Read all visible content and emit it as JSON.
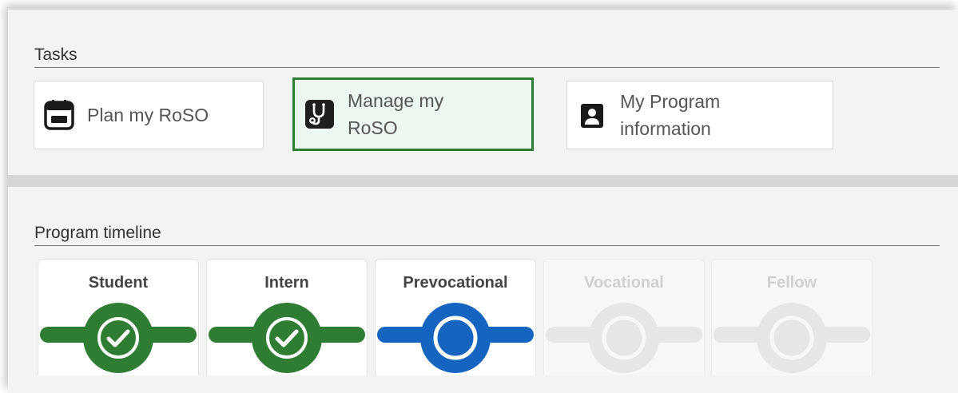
{
  "tasks": {
    "title": "Tasks",
    "items": [
      {
        "label_line1": "Plan my RoSO",
        "label_line2": "",
        "icon": "calendar-icon"
      },
      {
        "label_line1": "Manage my",
        "label_line2": "RoSO",
        "icon": "stethoscope-icon"
      },
      {
        "label_line1": "My Program",
        "label_line2": "information",
        "icon": "contact-card-icon"
      }
    ]
  },
  "timeline": {
    "title": "Program timeline",
    "stages": [
      {
        "label": "Student",
        "status": "completed"
      },
      {
        "label": "Intern",
        "status": "completed"
      },
      {
        "label": "Prevocational",
        "status": "current"
      },
      {
        "label": "Vocational",
        "status": "upcoming"
      },
      {
        "label": "Fellow",
        "status": "upcoming"
      }
    ]
  },
  "colors": {
    "completed": "#2e7d32",
    "current": "#1565c0",
    "upcoming": "#e6e6e6",
    "active_border": "#2e7d32"
  }
}
